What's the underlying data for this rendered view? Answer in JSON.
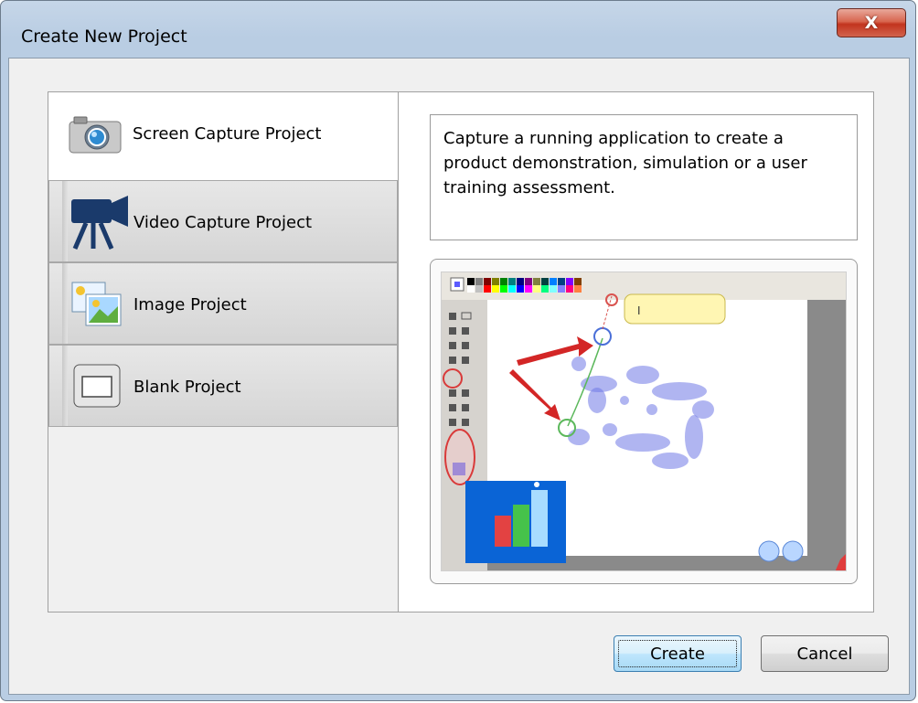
{
  "window": {
    "title": "Create New Project",
    "close_glyph": "X"
  },
  "tabs": [
    {
      "label": "Screen Capture Project",
      "icon": "camera-icon",
      "selected": true
    },
    {
      "label": "Video Capture Project",
      "icon": "video-camera-icon",
      "selected": false
    },
    {
      "label": "Image Project",
      "icon": "image-icon",
      "selected": false
    },
    {
      "label": "Blank Project",
      "icon": "blank-page-icon",
      "selected": false
    }
  ],
  "description": "Capture a running application to create a product demonstration, simulation or a user training assessment.",
  "preview": {
    "callout_text": "I"
  },
  "buttons": {
    "create": "Create",
    "cancel": "Cancel"
  },
  "colors": {
    "titlebar": "#b9cde3",
    "close_button": "#c2341e",
    "default_button_border": "#3c7fb1"
  }
}
